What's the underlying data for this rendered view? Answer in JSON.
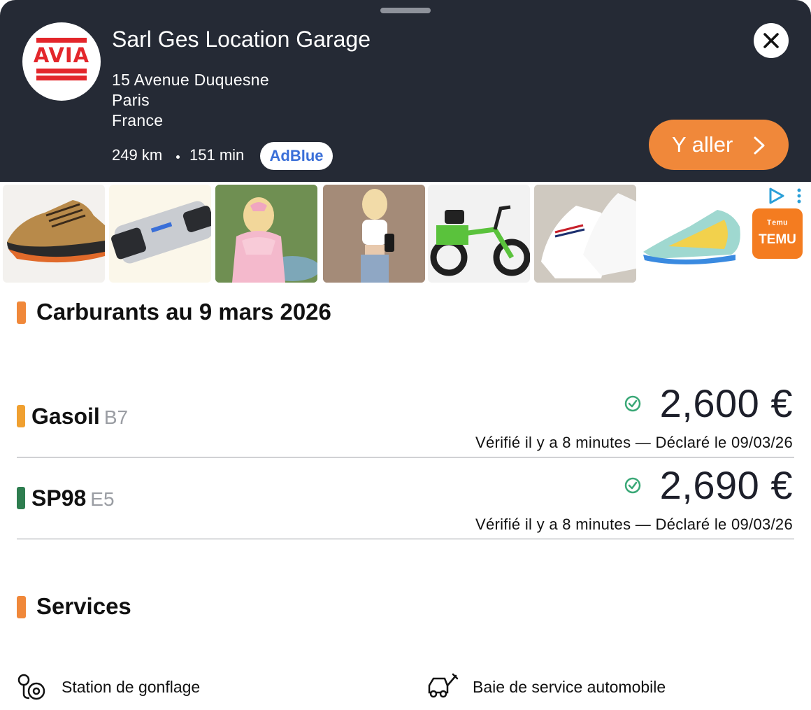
{
  "station": {
    "brand_logo": "AVIA",
    "name": "Sarl Ges Location Garage",
    "address": [
      "15 Avenue Duquesne",
      "Paris",
      "France"
    ],
    "distance": "249 km",
    "duration": "151 min",
    "badge": "AdBlue",
    "go_label": "Y aller"
  },
  "ad": {
    "products": [
      "hiking-shoe",
      "usb-card-reader",
      "pink-dress",
      "crop-top-outfit",
      "green-electric-trike",
      "white-sneakers",
      "running-shoe"
    ],
    "advertiser": "TEMU",
    "advertiser_top": "ᵀᵉᵐᵘ"
  },
  "fuels_section": {
    "title": "Carburants au 9 mars 2026",
    "items": [
      {
        "name": "Gasoil",
        "code": "B7",
        "price": "2,600 €",
        "verified": "Vérifié il y a 8 minutes — Déclaré le 09/03/26",
        "color": "#f0a030"
      },
      {
        "name": "SP98",
        "code": "E5",
        "price": "2,690 €",
        "verified": "Vérifié il y a 8 minutes — Déclaré le 09/03/26",
        "color": "#2e7d4f"
      }
    ]
  },
  "services_section": {
    "title": "Services",
    "items": [
      {
        "label": "Station de gonflage",
        "icon": "tire-pressure-icon"
      },
      {
        "label": "Baie de service automobile",
        "icon": "car-service-icon"
      }
    ]
  },
  "colors": {
    "header_bg": "#252a35",
    "accent": "#f0883a",
    "verified_check": "#3aa877"
  }
}
